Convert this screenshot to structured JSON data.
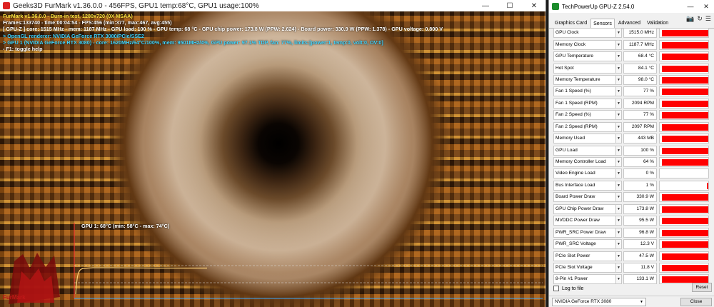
{
  "furmark": {
    "title": "Geeks3D FurMark v1.36.0.0 - 456FPS, GPU1 temp:68°C, GPU1 usage:100%",
    "overlay": [
      {
        "text": "FurMark v1.36.0.0 - Burn-in test, 1280x720 (0X MSAA)",
        "color": "yellow"
      },
      {
        "text": "Frames:133740 - time:00:04:54 - FPS:456 (min:377, max:467, avg:455)",
        "color": "white"
      },
      {
        "text": "[ GPU-Z ] core: 1515 MHz - mem: 1187 MHz - GPU load: 100 % - GPU temp: 68 °C - GPU chip power: 173.8 W (PPW: 2.624) - Board power: 330.9 W (PPW: 1.378) - GPU voltage: 0.800 V",
        "color": "white"
      },
      {
        "text": "> OpenGL renderer: NVIDIA GeForce RTX 3080/PCIe/SSE2",
        "color": "cyan"
      },
      {
        "text": "> GPU 1 (NVIDIA GeForce RTX 3080) - core: 1620MHz/64°C/100%, mem: 9501MHz/4%, GPU power: 97.1% TDP, fan: 77%, limits:[power:1, temp:0, volt:0, OV:0]",
        "color": "cyan"
      },
      {
        "text": "- F1: toggle help",
        "color": "white"
      }
    ],
    "graph_label": "GPU 1: 68°C (min: 58°C - max: 74°C)",
    "logo_text": "FurMark"
  },
  "gpuz": {
    "title": "TechPowerUp GPU-Z 2.54.0",
    "tabs": [
      "Graphics Card",
      "Sensors",
      "Advanced",
      "Validation"
    ],
    "active_tab": "Sensors",
    "sensors": [
      {
        "label": "GPU Clock",
        "value": "1515.0 MHz",
        "level": 0.95
      },
      {
        "label": "Memory Clock",
        "value": "1187.7 MHz",
        "level": 0.95
      },
      {
        "label": "GPU Temperature",
        "value": "68.4 °C",
        "level": 0.95
      },
      {
        "label": "Hot Spot",
        "value": "84.1 °C",
        "level": 0.95
      },
      {
        "label": "Memory Temperature",
        "value": "98.0 °C",
        "level": 0.95
      },
      {
        "label": "Fan 1 Speed (%)",
        "value": "77 %",
        "level": 0.95
      },
      {
        "label": "Fan 1 Speed (RPM)",
        "value": "2094 RPM",
        "level": 0.95
      },
      {
        "label": "Fan 2 Speed (%)",
        "value": "77 %",
        "level": 0.95
      },
      {
        "label": "Fan 2 Speed (RPM)",
        "value": "2097 RPM",
        "level": 0.95
      },
      {
        "label": "Memory Used",
        "value": "443 MB",
        "level": 0.95
      },
      {
        "label": "GPU Load",
        "value": "100 %",
        "level": 0.95
      },
      {
        "label": "Memory Controller Load",
        "value": "64 %",
        "level": 0.95
      },
      {
        "label": "Video Engine Load",
        "value": "0 %",
        "level": 0
      },
      {
        "label": "Bus Interface Load",
        "value": "1 %",
        "level": 0.03
      },
      {
        "label": "Board Power Draw",
        "value": "330.9 W",
        "level": 0.95
      },
      {
        "label": "GPU Chip Power Draw",
        "value": "173.8 W",
        "level": 0.95
      },
      {
        "label": "MVDDC Power Draw",
        "value": "95.5 W",
        "level": 0.95
      },
      {
        "label": "PWR_SRC Power Draw",
        "value": "96.8 W",
        "level": 0.95
      },
      {
        "label": "PWR_SRC Voltage",
        "value": "12.3 V",
        "level": 0.95
      },
      {
        "label": "PCIe Slot Power",
        "value": "47.5 W",
        "level": 0.95
      },
      {
        "label": "PCIe Slot Voltage",
        "value": "11.8 V",
        "level": 0.95
      },
      {
        "label": "8-Pin #1 Power",
        "value": "133.1 W",
        "level": 0.95
      }
    ],
    "log_to_file": "Log to file",
    "reset_label": "Reset",
    "gpu_select": "NVIDIA GeForce RTX 3080",
    "close_label": "Close",
    "colors": {
      "bar": "#ff0000"
    }
  },
  "icons": [
    "minimize-icon",
    "maximize-icon",
    "close-icon",
    "camera-icon",
    "refresh-icon",
    "menu-icon",
    "dropdown-arrow-icon"
  ]
}
